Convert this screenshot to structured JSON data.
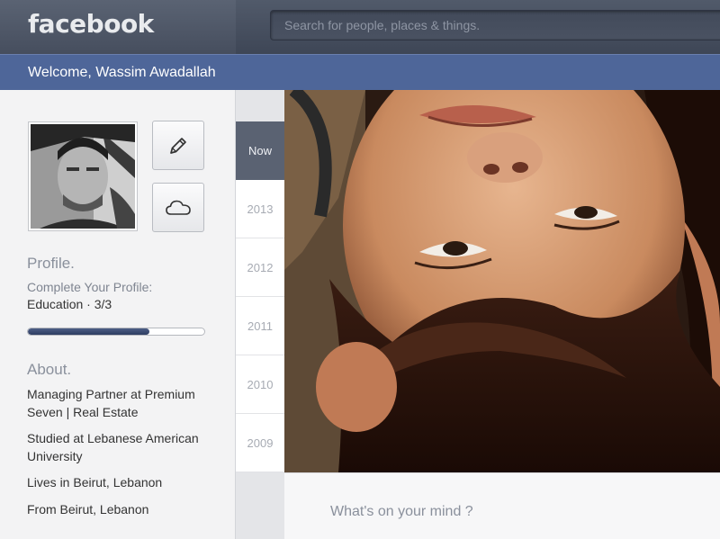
{
  "header": {
    "logo": "facebook",
    "search_placeholder": "Search for people, places & things."
  },
  "welcome": {
    "text": "Welcome, Wassim Awadallah"
  },
  "sidebar": {
    "edit_icon": "pencil-icon",
    "cloud_icon": "cloud-icon",
    "profile": {
      "title": "Profile.",
      "complete_label": "Complete Your Profile:",
      "step": "Education · 3/3",
      "progress_fraction": 0.69
    },
    "about": {
      "title": "About.",
      "items": [
        "Managing Partner at Premium Seven | Real Estate",
        "Studied at Lebanese American University",
        "Lives in Beirut, Lebanon",
        "From Beirut, Lebanon"
      ]
    }
  },
  "timeline": {
    "items": [
      "Now",
      "2013",
      "2012",
      "2011",
      "2010",
      "2009"
    ],
    "active_index": 0
  },
  "composer": {
    "placeholder": "What's on your mind ?"
  },
  "colors": {
    "topbar": "#465062",
    "welcome_bar": "#4e6699",
    "timeline_active": "#5a6272",
    "progress_fill": "#3a4a70"
  }
}
